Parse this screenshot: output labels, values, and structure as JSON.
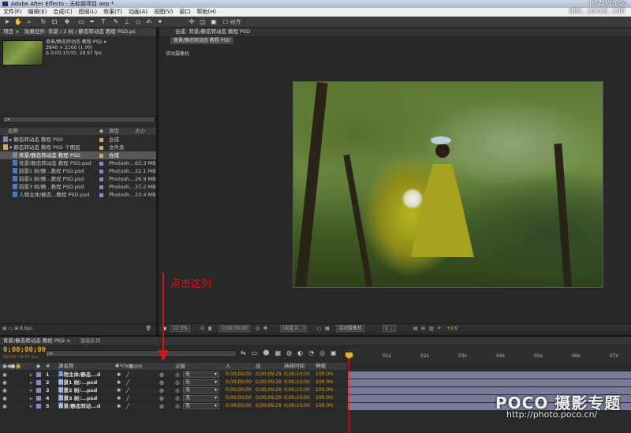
{
  "window": {
    "title": "Adobe After Effects - 无标题项目.aep *"
  },
  "watermarks": {
    "top1": "PS教程论坛",
    "top2": "BBS.16XX8.COM",
    "bottom1": "POCO 摄影专题",
    "bottom2": "http://photo.poco.cn/"
  },
  "menu": [
    "文件(F)",
    "编辑(E)",
    "合成(C)",
    "图层(L)",
    "效果(T)",
    "动画(A)",
    "视图(V)",
    "窗口",
    "帮助(H)"
  ],
  "toolbar": {
    "align_label": "对齐"
  },
  "project": {
    "tab_label": "项目 ×",
    "effects_tab": "效果控件: 背景 / 2 树 / 静态转动态 教程 PSD.ps",
    "comp_name": "背景/静态转动态 教程 PSD ▾",
    "comp_dims": "3840 × 2160 (1.00)",
    "comp_duration": "Δ 0;00;10;00, 29.97 fps",
    "search_placeholder": "ρ▾",
    "col_name": "名称",
    "col_type": "类型",
    "col_size": "大小",
    "items": [
      {
        "name": "▸ 静态转动态 教程 PSD",
        "type": "合成",
        "size": "",
        "color": "#c8b060",
        "selected": false,
        "indent": 4,
        "kind": "comp"
      },
      {
        "name": "▾ 静态转动态 教程 PSD 个图层",
        "type": "文件夹",
        "size": "",
        "color": "#c8b060",
        "selected": false,
        "indent": 4,
        "kind": "folder"
      },
      {
        "name": "背景/静态转动态 教程 PSD",
        "type": "合成",
        "size": "",
        "color": "#c8b060",
        "selected": true,
        "indent": 16,
        "kind": "comp"
      },
      {
        "name": "背景/静态转动态 教程 PSD.psd",
        "type": "Photosh...",
        "size": "63.3 MB",
        "color": "#8a8ac0",
        "selected": false,
        "indent": 16,
        "kind": "psd"
      },
      {
        "name": "前景1 树/静...教程 PSD.psd",
        "type": "Photosh...",
        "size": "22.1 MB",
        "color": "#8a8ac0",
        "selected": false,
        "indent": 16,
        "kind": "psd"
      },
      {
        "name": "前景2 树/静...教程 PSD.psd",
        "type": "Photosh...",
        "size": "26.9 MB",
        "color": "#8a8ac0",
        "selected": false,
        "indent": 16,
        "kind": "psd"
      },
      {
        "name": "前景3 树/静...教程 PSD.psd",
        "type": "Photosh...",
        "size": "27.2 MB",
        "color": "#8a8ac0",
        "selected": false,
        "indent": 16,
        "kind": "psd"
      },
      {
        "name": "人物主体/静态...教程 PSD.psd",
        "type": "Photosh...",
        "size": "23.4 MB",
        "color": "#8a8ac0",
        "selected": false,
        "indent": 16,
        "kind": "psd"
      }
    ],
    "bpc": "8 bpc"
  },
  "comp": {
    "tab_label": "合成: 背景/静态转动态 教程 PSD",
    "subtab": "背景/静态转动态 教程 PSD",
    "view_label": "活动摄像机",
    "zoom": "12.5%",
    "timecode": "0;00;00;00",
    "resolution": "(自定义...)",
    "camera": "活动摄像机",
    "views": "1 ...",
    "exposure": "+0.0"
  },
  "annotation": "点击这列",
  "timeline": {
    "tab_label": "背景/静态转动态 教程 PSD ×",
    "render_tab": "渲染队列",
    "current_time": "0;00;00;00",
    "fps_note": "00000 (29.97 fps)",
    "search_placeholder": "ρ▾",
    "col_layer_name": "源名称",
    "col_parent": "父级",
    "col_in": "入",
    "col_out": "出",
    "col_duration": "持续时间",
    "col_stretch": "伸缩",
    "ruler": [
      "0s",
      "01s",
      "02s",
      "03s",
      "04s",
      "05s",
      "06s",
      "07s"
    ],
    "layers": [
      {
        "num": "1",
        "name": "人物主体/静态...d",
        "parent": "无",
        "in": "0;00;00;00",
        "out": "0;00;09;29",
        "dur": "0;00;10;00",
        "stretch": "100.0%"
      },
      {
        "num": "2",
        "name": "前景1 树/...psd",
        "parent": "无",
        "in": "0;00;00;00",
        "out": "0;00;09;29",
        "dur": "0;00;10;00",
        "stretch": "100.0%"
      },
      {
        "num": "3",
        "name": "前景2 树/...psd",
        "parent": "无",
        "in": "0;00;00;00",
        "out": "0;00;09;29",
        "dur": "0;00;10;00",
        "stretch": "100.0%"
      },
      {
        "num": "4",
        "name": "前景3 树/...psd",
        "parent": "无",
        "in": "0;00;00;00",
        "out": "0;00;09;29",
        "dur": "0;00;10;00",
        "stretch": "100.0%"
      },
      {
        "num": "5",
        "name": "背景/静态转动...d",
        "parent": "无",
        "in": "0;00;00;00",
        "out": "0;00;09;29",
        "dur": "0;00;10;00",
        "stretch": "100.0%"
      }
    ]
  }
}
